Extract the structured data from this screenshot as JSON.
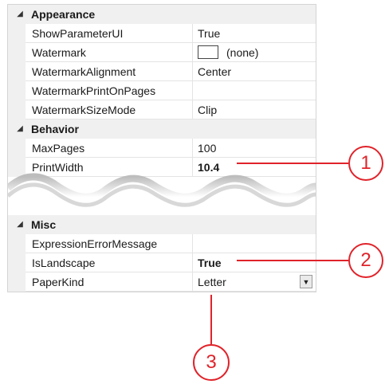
{
  "categories": [
    {
      "label": "Appearance",
      "properties": [
        {
          "name": "ShowParameterUI",
          "value": "True"
        },
        {
          "name": "Watermark",
          "value": "(none)"
        },
        {
          "name": "WatermarkAlignment",
          "value": "Center"
        },
        {
          "name": "WatermarkPrintOnPages",
          "value": ""
        },
        {
          "name": "WatermarkSizeMode",
          "value": "Clip"
        }
      ]
    },
    {
      "label": "Behavior",
      "properties": [
        {
          "name": "MaxPages",
          "value": "100"
        },
        {
          "name": "PrintWidth",
          "value": "10.4"
        }
      ]
    },
    {
      "label": "Misc",
      "properties": [
        {
          "name": "ExpressionErrorMessage",
          "value": ""
        },
        {
          "name": "IsLandscape",
          "value": "True"
        },
        {
          "name": "PaperKind",
          "value": "Letter"
        }
      ]
    }
  ],
  "callouts": [
    "1",
    "2",
    "3"
  ],
  "icons": {
    "expand": "expanded-triangle-icon",
    "dropdown": "dropdown-arrow-icon"
  },
  "colors": {
    "callout": "#e0232a",
    "category_bg": "#f0f0f0",
    "border": "#d4d4d4"
  }
}
